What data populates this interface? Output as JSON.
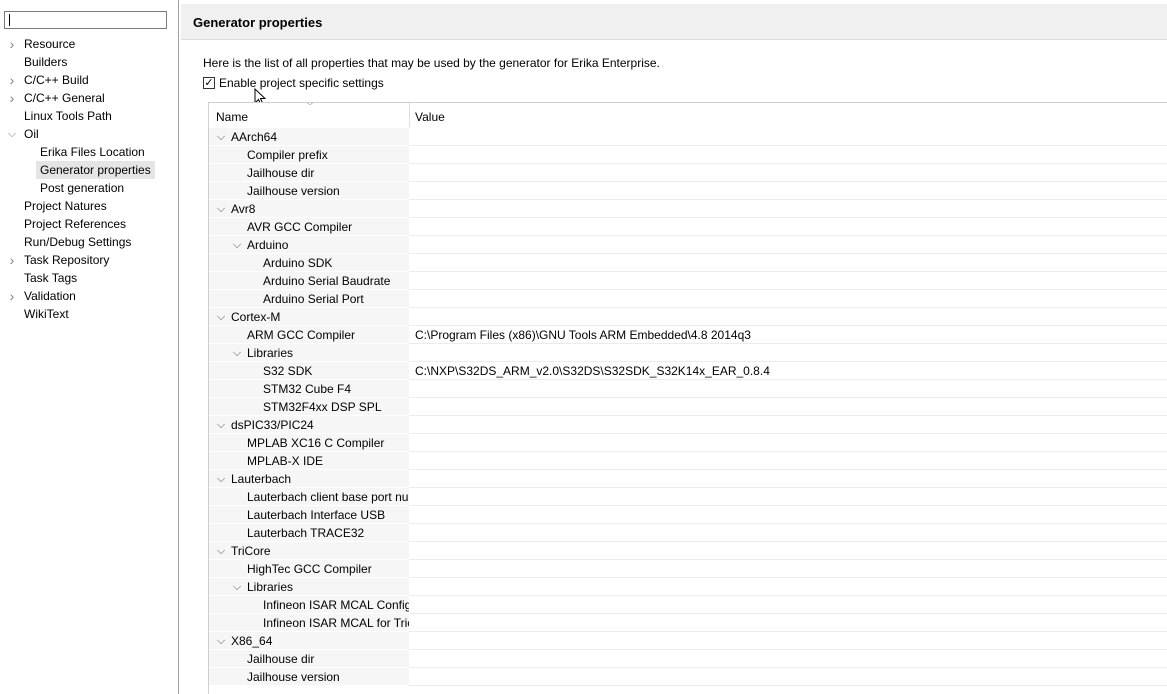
{
  "nav": {
    "filter_value": "",
    "items": [
      {
        "label": "Resource",
        "expander": "closed",
        "level": 0
      },
      {
        "label": "Builders",
        "expander": "none",
        "level": 0
      },
      {
        "label": "C/C++ Build",
        "expander": "closed",
        "level": 0
      },
      {
        "label": "C/C++ General",
        "expander": "closed",
        "level": 0
      },
      {
        "label": "Linux Tools Path",
        "expander": "none",
        "level": 0
      },
      {
        "label": "Oil",
        "expander": "open",
        "level": 0
      },
      {
        "label": "Erika Files Location",
        "expander": "none",
        "level": 1
      },
      {
        "label": "Generator properties",
        "expander": "none",
        "level": 1,
        "selected": true
      },
      {
        "label": "Post generation",
        "expander": "none",
        "level": 1
      },
      {
        "label": "Project Natures",
        "expander": "none",
        "level": 0
      },
      {
        "label": "Project References",
        "expander": "none",
        "level": 0
      },
      {
        "label": "Run/Debug Settings",
        "expander": "none",
        "level": 0
      },
      {
        "label": "Task Repository",
        "expander": "closed",
        "level": 0
      },
      {
        "label": "Task Tags",
        "expander": "none",
        "level": 0
      },
      {
        "label": "Validation",
        "expander": "closed",
        "level": 0
      },
      {
        "label": "WikiText",
        "expander": "none",
        "level": 0
      }
    ]
  },
  "page": {
    "title": "Generator properties",
    "description": "Here is the list of all properties that may be used by the generator for Erika Enterprise.",
    "enable_checkbox": {
      "label": "Enable project specific settings",
      "checked": true
    }
  },
  "table": {
    "columns": [
      "Name",
      "Value"
    ],
    "rows": [
      {
        "name": "AArch64",
        "level": 0,
        "expander": "open",
        "value": ""
      },
      {
        "name": "Compiler prefix",
        "level": 1,
        "expander": "none",
        "value": ""
      },
      {
        "name": "Jailhouse dir",
        "level": 1,
        "expander": "none",
        "value": ""
      },
      {
        "name": "Jailhouse version",
        "level": 1,
        "expander": "none",
        "value": ""
      },
      {
        "name": "Avr8",
        "level": 0,
        "expander": "open",
        "value": ""
      },
      {
        "name": "AVR GCC Compiler",
        "level": 1,
        "expander": "none",
        "value": ""
      },
      {
        "name": "Arduino",
        "level": 1,
        "expander": "open",
        "value": ""
      },
      {
        "name": "Arduino SDK",
        "level": 2,
        "expander": "none",
        "value": ""
      },
      {
        "name": "Arduino Serial Baudrate",
        "level": 2,
        "expander": "none",
        "value": ""
      },
      {
        "name": "Arduino Serial Port",
        "level": 2,
        "expander": "none",
        "value": ""
      },
      {
        "name": "Cortex-M",
        "level": 0,
        "expander": "open",
        "value": ""
      },
      {
        "name": "ARM GCC Compiler",
        "level": 1,
        "expander": "none",
        "value": "C:\\Program Files (x86)\\GNU Tools ARM Embedded\\4.8 2014q3"
      },
      {
        "name": "Libraries",
        "level": 1,
        "expander": "open",
        "value": ""
      },
      {
        "name": "S32 SDK",
        "level": 2,
        "expander": "none",
        "value": "C:\\NXP\\S32DS_ARM_v2.0\\S32DS\\S32SDK_S32K14x_EAR_0.8.4"
      },
      {
        "name": "STM32 Cube F4",
        "level": 2,
        "expander": "none",
        "value": ""
      },
      {
        "name": "STM32F4xx DSP SPL",
        "level": 2,
        "expander": "none",
        "value": ""
      },
      {
        "name": "dsPIC33/PIC24",
        "level": 0,
        "expander": "open",
        "value": ""
      },
      {
        "name": "MPLAB XC16 C Compiler",
        "level": 1,
        "expander": "none",
        "value": ""
      },
      {
        "name": "MPLAB-X IDE",
        "level": 1,
        "expander": "none",
        "value": ""
      },
      {
        "name": "Lauterbach",
        "level": 0,
        "expander": "open",
        "value": ""
      },
      {
        "name": "Lauterbach client base port nui",
        "level": 1,
        "expander": "none",
        "value": ""
      },
      {
        "name": "Lauterbach Interface USB",
        "level": 1,
        "expander": "none",
        "value": ""
      },
      {
        "name": "Lauterbach TRACE32",
        "level": 1,
        "expander": "none",
        "value": ""
      },
      {
        "name": "TriCore",
        "level": 0,
        "expander": "open",
        "value": ""
      },
      {
        "name": "HighTec GCC Compiler",
        "level": 1,
        "expander": "none",
        "value": ""
      },
      {
        "name": "Libraries",
        "level": 1,
        "expander": "open",
        "value": ""
      },
      {
        "name": "Infineon ISAR MCAL Config",
        "level": 2,
        "expander": "none",
        "value": ""
      },
      {
        "name": "Infineon ISAR MCAL for Tric",
        "level": 2,
        "expander": "none",
        "value": ""
      },
      {
        "name": "X86_64",
        "level": 0,
        "expander": "open",
        "value": ""
      },
      {
        "name": "Jailhouse dir",
        "level": 1,
        "expander": "none",
        "value": ""
      },
      {
        "name": "Jailhouse version",
        "level": 1,
        "expander": "none",
        "value": ""
      }
    ]
  }
}
